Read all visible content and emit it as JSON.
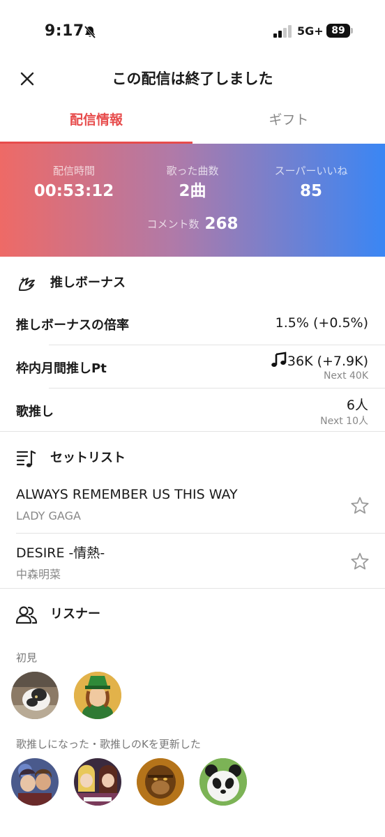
{
  "status_bar": {
    "time": "9:17",
    "network": "5G+",
    "battery": "89"
  },
  "header": {
    "title": "この配信は終了しました"
  },
  "tabs": [
    {
      "label": "配信情報",
      "active": true
    },
    {
      "label": "ギフト",
      "active": false
    }
  ],
  "stats": {
    "duration_label": "配信時間",
    "duration_value": "00:53:12",
    "songs_label": "歌った曲数",
    "songs_value": "2曲",
    "superlike_label": "スーパーいいね",
    "superlike_value": "85",
    "comments_label": "コメント数",
    "comments_value": "268"
  },
  "oshi_bonus": {
    "title": "推しボーナス",
    "rows": [
      {
        "label": "推しボーナスの倍率",
        "value": "1.5% (+0.5%)",
        "sub": ""
      },
      {
        "label": "枠内月間推しPt",
        "value": "36K (+7.9K)",
        "sub": "Next 40K"
      },
      {
        "label": "歌推し",
        "value": "6人",
        "sub": "Next 10人"
      }
    ]
  },
  "setlist": {
    "title": "セットリスト",
    "songs": [
      {
        "title": "ALWAYS REMEMBER US THIS WAY",
        "artist": "LADY GAGA"
      },
      {
        "title": "DESIRE -情熱-",
        "artist": "中森明菜"
      }
    ]
  },
  "listeners": {
    "title": "リスナー",
    "first_time_label": "初見",
    "uta_oshi_label": "歌推しになった・歌推しのKを更新した"
  },
  "colors": {
    "accent": "#e74c4c",
    "gradient_start": "#ee6a66",
    "gradient_end": "#3a86f4"
  }
}
